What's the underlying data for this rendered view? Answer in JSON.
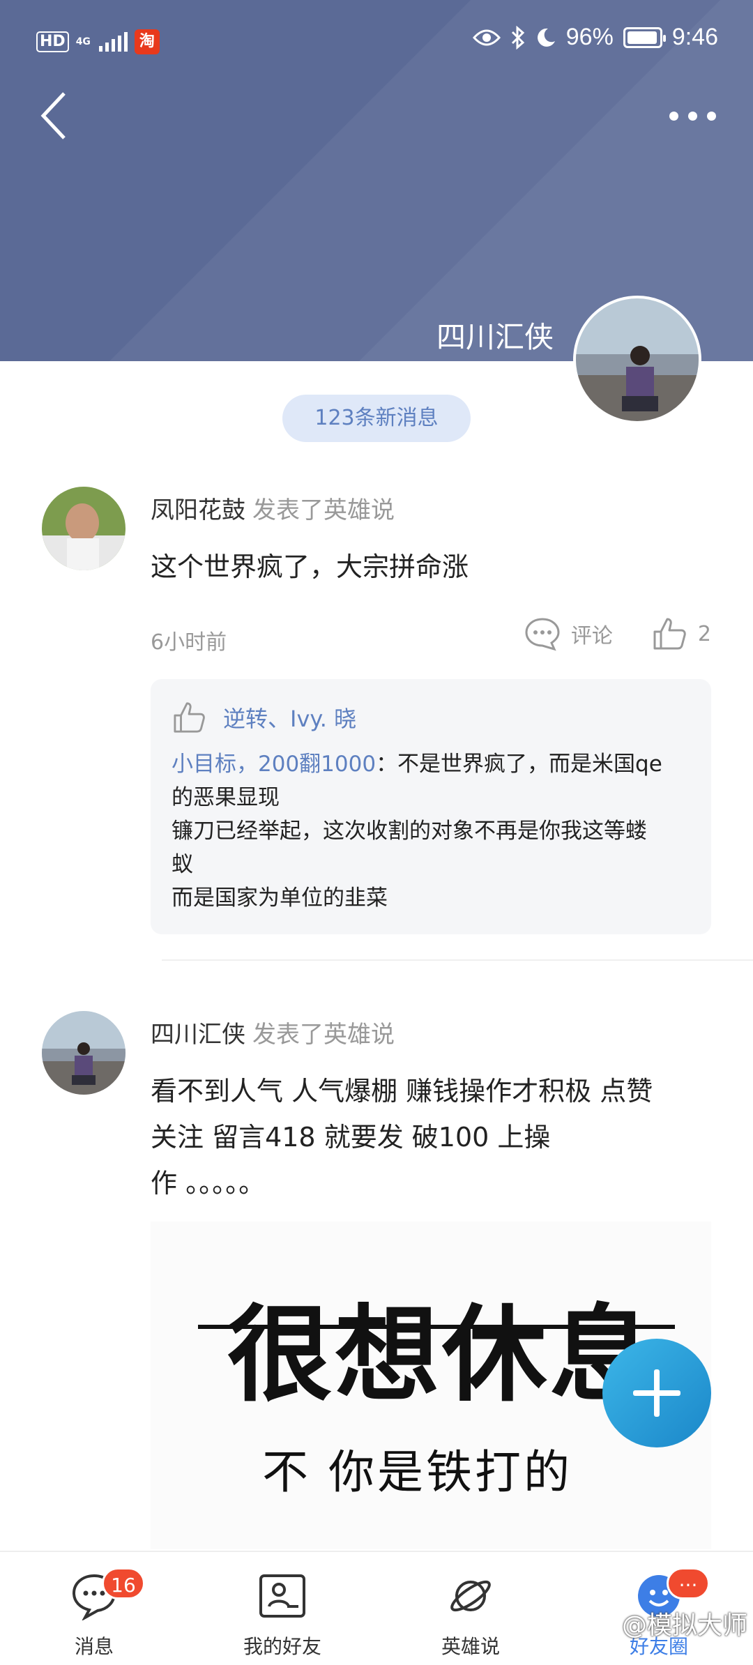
{
  "status_bar": {
    "hd": "HD",
    "network": "4G",
    "battery": "96%",
    "battery_level": 0.96,
    "time": "9:46"
  },
  "header": {
    "owner_name": "四川汇侠"
  },
  "new_messages": "123条新消息",
  "posts": [
    {
      "author": "凤阳花鼓",
      "action": "发表了英雄说",
      "text": "这个世界疯了，大宗拼命涨",
      "time": "6小时前",
      "comment_label": "评论",
      "like_count": "2",
      "likers": "逆转、Ivy. 晓",
      "comment_author": "小目标，200翻1000",
      "comment_lines": [
        "：不是世界疯了，而是米国qe",
        "的恶果显现",
        "镰刀已经举起，这次收割的对象不再是你我这等蝼",
        "蚁",
        "而是国家为单位的韭菜"
      ]
    },
    {
      "author": "四川汇侠",
      "action": "发表了英雄说",
      "text_lines": [
        "看不到人气 人气爆棚 赚钱操作才积极 点赞",
        "关注 留言418 就要发 破100 上操",
        "作 。。。。。"
      ],
      "image_big_text": "很想休息",
      "image_sub_text": "不 你是铁打的"
    }
  ],
  "bottom_nav": [
    {
      "label": "消息",
      "icon": "chat-bubble-icon",
      "badge": "16"
    },
    {
      "label": "我的好友",
      "icon": "contact-card-icon"
    },
    {
      "label": "英雄说",
      "icon": "planet-icon"
    },
    {
      "label": "好友圈",
      "icon": "friends-circle-icon",
      "badge": "···"
    }
  ],
  "watermark": "@模拟大师",
  "colors": {
    "header_bg": "#5b6a96",
    "accent_blue": "#5e80c0",
    "badge_red": "#f04a2f",
    "fab_blue": "#2a9fd8"
  }
}
